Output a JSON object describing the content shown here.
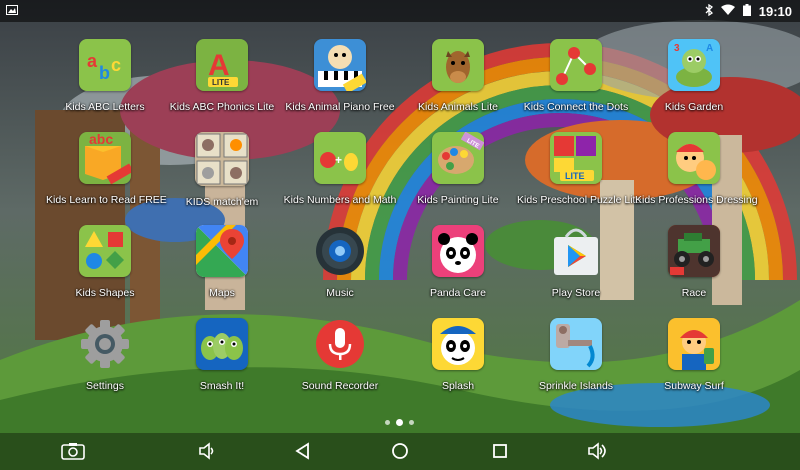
{
  "status": {
    "time": "19:10",
    "icons": [
      "bluetooth-icon",
      "wifi-icon",
      "battery-icon"
    ]
  },
  "apps": [
    {
      "label": "Kids ABC Letters",
      "icon": "abc-letters-icon"
    },
    {
      "label": "Kids ABC Phonics Lite",
      "icon": "abc-phonics-icon"
    },
    {
      "label": "Kids Animal Piano Free",
      "icon": "animal-piano-icon"
    },
    {
      "label": "Kids Animals Lite",
      "icon": "animals-horse-icon"
    },
    {
      "label": "Kids Connect the Dots",
      "icon": "connect-dots-icon"
    },
    {
      "label": "Kids Garden",
      "icon": "garden-turtle-icon"
    },
    {
      "label": "Kids Learn to Read FREE",
      "icon": "learn-read-icon"
    },
    {
      "label": "KIDS match'em",
      "icon": "match-em-icon"
    },
    {
      "label": "Kids Numbers and Math",
      "icon": "numbers-math-icon"
    },
    {
      "label": "Kids Painting Lite",
      "icon": "painting-palette-icon"
    },
    {
      "label": "Kids Preschool Puzzle Lite",
      "icon": "preschool-puzzle-icon"
    },
    {
      "label": "Kids Professions Dressing",
      "icon": "professions-dressing-icon"
    },
    {
      "label": "Kids Shapes",
      "icon": "shapes-icon"
    },
    {
      "label": "Maps",
      "icon": "maps-icon"
    },
    {
      "label": "Music",
      "icon": "music-speaker-icon"
    },
    {
      "label": "Panda Care",
      "icon": "panda-care-icon"
    },
    {
      "label": "Play Store",
      "icon": "play-store-icon"
    },
    {
      "label": "Race",
      "icon": "race-truck-icon"
    },
    {
      "label": "Settings",
      "icon": "settings-gear-icon"
    },
    {
      "label": "Smash It!",
      "icon": "smash-it-icon"
    },
    {
      "label": "Sound Recorder",
      "icon": "microphone-icon"
    },
    {
      "label": "Splash",
      "icon": "splash-panda-icon"
    },
    {
      "label": "Sprinkle Islands",
      "icon": "sprinkle-islands-icon"
    },
    {
      "label": "Subway Surf",
      "icon": "subway-surf-icon"
    }
  ],
  "badges": {
    "lite": "LITE",
    "free": "FREE",
    "abc": "abc"
  },
  "pager": {
    "pages": 3,
    "current": 2
  },
  "navbar": [
    "screenshot-icon",
    "volume-down-icon",
    "back-icon",
    "home-icon",
    "recents-icon",
    "volume-up-icon"
  ]
}
